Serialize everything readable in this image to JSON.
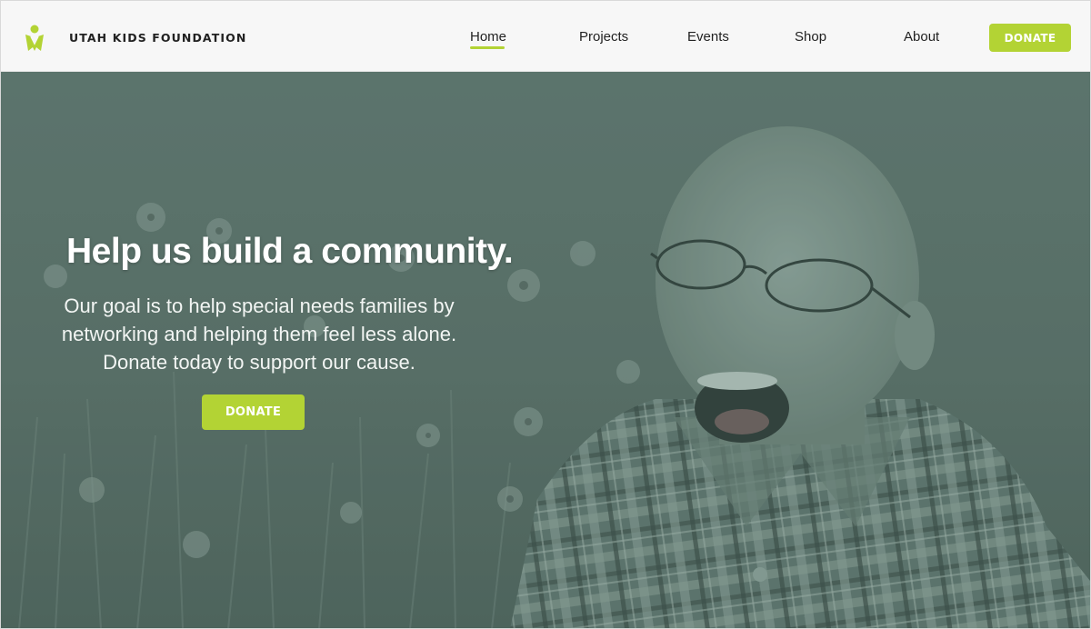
{
  "brand": {
    "name": "UTAH KIDS FOUNDATION",
    "logo_icon": "person-ribbon-logo"
  },
  "nav": {
    "items": [
      {
        "label": "Home",
        "active": true
      },
      {
        "label": "Projects",
        "active": false
      },
      {
        "label": "Events",
        "active": false
      },
      {
        "label": "Shop",
        "active": false
      },
      {
        "label": "About",
        "active": false
      }
    ],
    "donate_label": "DONATE"
  },
  "hero": {
    "title": "Help us build a community.",
    "subtitle": "Our goal is to help special needs families by networking and helping them feel less alone. Donate today to support our cause.",
    "donate_label": "DONATE"
  },
  "colors": {
    "accent": "#b3d334",
    "header_bg": "#f7f7f7",
    "hero_tint": "#5a7069",
    "text_dark": "#222222"
  }
}
